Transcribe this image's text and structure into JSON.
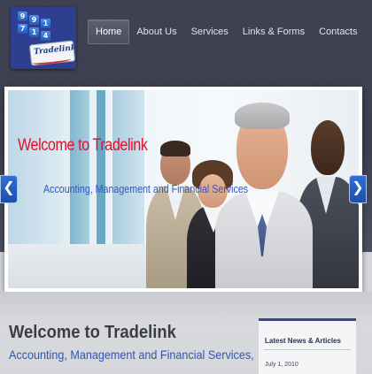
{
  "logo": {
    "keys": [
      "9",
      "9",
      "1",
      "7",
      "1",
      "4"
    ],
    "text": "Tradelink"
  },
  "nav": {
    "items": [
      {
        "label": "Home",
        "active": true
      },
      {
        "label": "About Us"
      },
      {
        "label": "Services"
      },
      {
        "label": "Links & Forms"
      },
      {
        "label": "Contacts"
      }
    ]
  },
  "slider": {
    "title": "Welcome to Tradelink",
    "subtitle": "Accounting, Management and Financial Services",
    "prev_icon": "chevron-left-icon",
    "next_icon": "chevron-right-icon",
    "prev_glyph": "❮",
    "next_glyph": "❯"
  },
  "content": {
    "title": "Welcome to Tradelink",
    "subtitle": "Accounting, Management and Financial Services,"
  },
  "news": {
    "title": "Latest News & Articles",
    "date": "July 1, 2010"
  },
  "colors": {
    "header_bg": "#3d4050",
    "slide_title": "#e2102a",
    "slide_subtitle": "#2b56d6",
    "arrow": "#2f6fd8",
    "welcome_subtitle": "#2e55b8"
  }
}
